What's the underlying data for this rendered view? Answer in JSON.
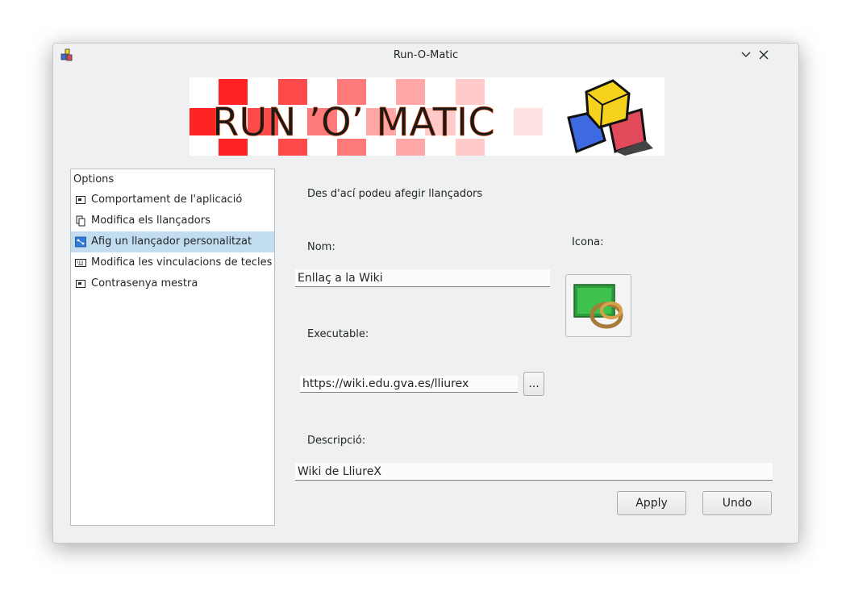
{
  "window": {
    "title": "Run-O-Matic"
  },
  "banner": {
    "text": "RUN ’O’ MATIC"
  },
  "options": {
    "header": "Options",
    "items": [
      {
        "label": "Comportament de l'aplicació",
        "icon": "window-icon"
      },
      {
        "label": "Modifica els llançadors",
        "icon": "copy-icon"
      },
      {
        "label": "Afig un llançador personalitzat",
        "icon": "network-icon",
        "selected": true
      },
      {
        "label": "Modifica les vinculacions de tecles",
        "icon": "keyboard-icon"
      },
      {
        "label": "Contrasenya mestra",
        "icon": "window-icon"
      }
    ]
  },
  "form": {
    "intro": "Des d'ací podeu afegir llançadors",
    "name_label": "Nom:",
    "name_value": "Enllaç a la Wiki",
    "icon_label": "Icona:",
    "executable_label": "Executable:",
    "executable_value": "https://wiki.edu.gva.es/lliurex",
    "browse_label": "...",
    "description_label": "Descripció:",
    "description_value": "Wiki de LliureX",
    "apply_label": "Apply",
    "undo_label": "Undo"
  }
}
